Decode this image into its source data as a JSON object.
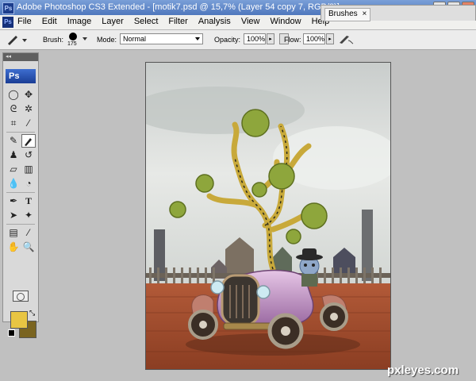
{
  "window": {
    "title": "Adobe Photoshop CS3 Extended - [motik7.psd @ 15,7% (Layer 54 copy 7, RGB/8)]",
    "app_icon": "Ps"
  },
  "menu": [
    "File",
    "Edit",
    "Image",
    "Layer",
    "Select",
    "Filter",
    "Analysis",
    "View",
    "Window",
    "Help"
  ],
  "menu_logo": "Ps",
  "panel": {
    "tab_label": "Brushes",
    "tab_close": "×"
  },
  "options_bar": {
    "brush_label": "Brush:",
    "brush_size": "175",
    "mode_label": "Mode:",
    "mode_value": "Normal",
    "opacity_label": "Opacity:",
    "opacity_value": "100%",
    "flow_label": "Flow:",
    "flow_value": "100%"
  },
  "toolbox": {
    "grip": "◂◂",
    "logo": "Ps",
    "foreground_color": "#e8c543",
    "background_color": "#7a6420"
  },
  "canvas": {
    "description_icons": [
      "tree-icon",
      "car-icon"
    ]
  },
  "watermark": "pxleyes.com"
}
